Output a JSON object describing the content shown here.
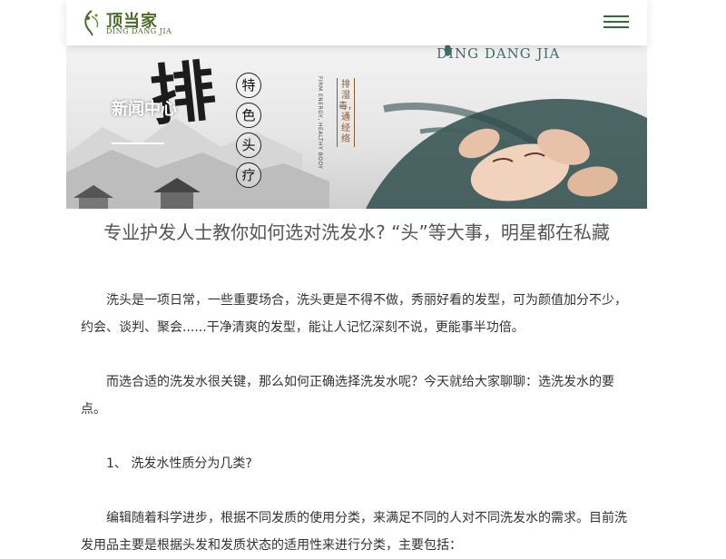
{
  "header": {
    "logo_cn": "顶当家",
    "logo_en": "DING DANG JIA",
    "menu_icon": "hamburger-menu-icon"
  },
  "banner": {
    "section_title": "新闻中心",
    "big_char": "排",
    "features": [
      "特",
      "色",
      "头",
      "疗"
    ],
    "slogan_cn": "排湿毒，通经络",
    "slogan_en": "FIRM ENERGY, HEALTHY BODY",
    "brand_en": "DING DANG JIA"
  },
  "article": {
    "title": "专业护发人士教你如何选对洗发水? “头”等大事，明星都在私藏",
    "paragraphs": [
      "洗头是一项日常，一些重要场合，洗头更是不得不做，秀丽好看的发型，可为颜值加分不少，约会、谈判、聚会......干净清爽的发型，能让人记忆深刻不说，更能事半功倍。",
      "而选合适的洗发水很关键，那么如何正确选择洗发水呢？今天就给大家聊聊：选洗发水的要点。",
      "1、 洗发水性质分为几类?",
      "编辑随着科学进步，根据不同发质的使用分类，来满足不同的人对不同洗发水的需求。目前洗发用品主要是根据头发和发质状态的适用性来进行分类，主要包括："
    ]
  },
  "colors": {
    "brand_green": "#2e6e36",
    "logo_green": "#4d6b2a",
    "title_gray": "#555555",
    "body_text": "#333333"
  }
}
